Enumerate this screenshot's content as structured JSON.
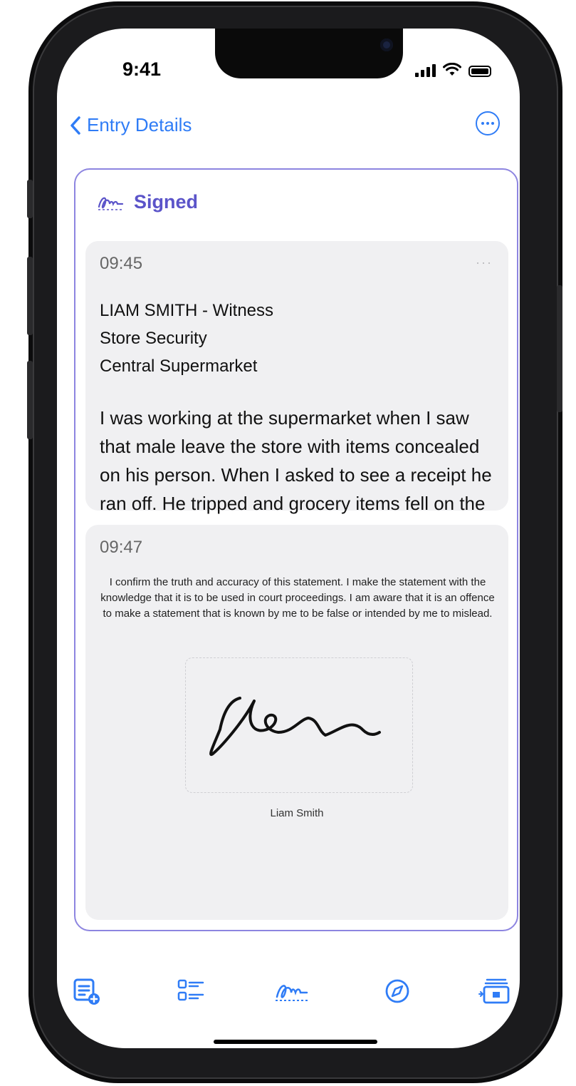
{
  "status_bar": {
    "time": "9:41"
  },
  "nav": {
    "back_label": "Entry Details"
  },
  "card": {
    "badge_label": "Signed",
    "entries": [
      {
        "time": "09:45",
        "more": "···",
        "header_lines": [
          "LIAM SMITH - Witness",
          "Store Security",
          "Central Supermarket"
        ],
        "body": "I was working at the supermarket when I saw that male leave the store with items concealed on his person. When I asked to see a receipt he ran off. He tripped and  grocery items fell on the ground."
      },
      {
        "time": "09:47",
        "declaration": "I confirm the truth and accuracy of this statement. I make the statement with the knowledge that it is to be used in court proceedings. I am aware that it is an offence to make a statement that is known by me to be false or intended by me to mislead.",
        "signatory": "Liam Smith"
      }
    ]
  },
  "tabbar": {
    "items": [
      "add-note-icon",
      "checklist-icon",
      "signature-icon",
      "compass-icon",
      "presentation-icon"
    ]
  },
  "colors": {
    "accent": "#2f7cf6",
    "signed": "#5b54c9",
    "card_border": "#8d85e0"
  }
}
